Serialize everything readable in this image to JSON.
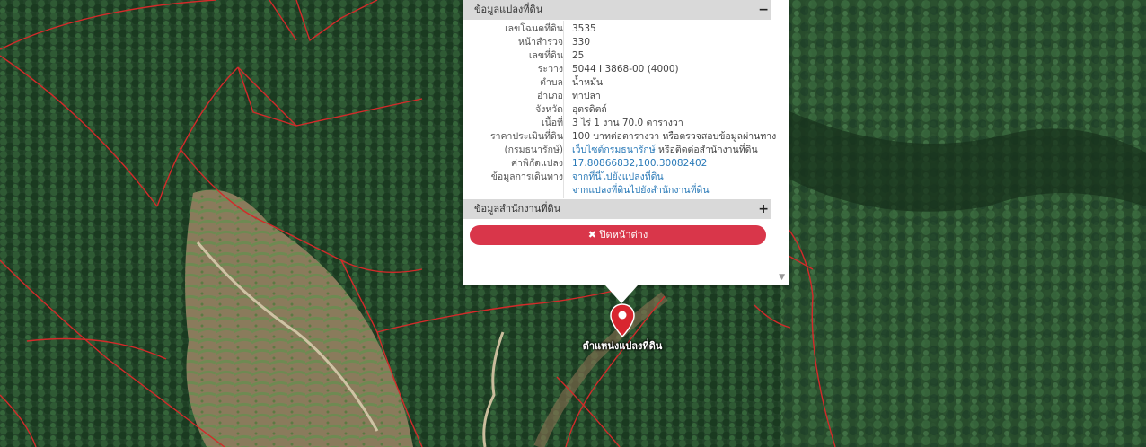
{
  "map": {
    "colors": {
      "forest_dark": "#1c3520",
      "forest_mid": "#2c5231",
      "cleared": "#8a7b5d",
      "parcel_line": "#d32a2a"
    }
  },
  "popup": {
    "section1_title": "ข้อมูลแปลงที่ดิน",
    "section1_toggle": "−",
    "rows": [
      {
        "label": "เลขโฉนดที่ดิน",
        "value": "3535",
        "link": false
      },
      {
        "label": "หน้าสำรวจ",
        "value": "330",
        "link": false
      },
      {
        "label": "เลขที่ดิน",
        "value": "25",
        "link": false
      },
      {
        "label": "ระวาง",
        "value": "5044 I 3868-00 (4000)",
        "link": false
      },
      {
        "label": "ตำบล",
        "value": "น้ำหมัน",
        "link": false
      },
      {
        "label": "อำเภอ",
        "value": "ท่าปลา",
        "link": false
      },
      {
        "label": "จังหวัด",
        "value": "อุตรดิตถ์",
        "link": false
      },
      {
        "label": "เนื้อที่",
        "value": "3 ไร่ 1 งาน 70.0 ตารางวา",
        "link": false
      },
      {
        "label": "ราคาประเมินที่ดิน",
        "value": "100 บาทต่อตารางวา หรือตรวจสอบข้อมูลผ่านทาง",
        "link": false
      },
      {
        "label": "(กรมธนารักษ์)",
        "value": "เว็บไซต์กรมธนารักษ์",
        "value2": " หรือติดต่อสำนักงานที่ดิน",
        "link": true
      },
      {
        "label": "ค่าพิกัดแปลง",
        "value": "17.80866832,100.30082402",
        "link": true
      },
      {
        "label": "ข้อมูลการเดินทาง",
        "value": "จากที่นี่ไปยังแปลงที่ดิน",
        "link": true
      },
      {
        "label": "",
        "value": "จากแปลงที่ดินไปยังสำนักงานที่ดิน",
        "link": true
      }
    ],
    "section2_title": "ข้อมูลสำนักงานที่ดิน",
    "section2_toggle": "+",
    "close_label": "✖ ปิดหน้าต่าง",
    "scroll_arrow": "▼"
  },
  "marker": {
    "label": "ตำแหน่งแปลงที่ดิน",
    "color": "#d8262f"
  }
}
